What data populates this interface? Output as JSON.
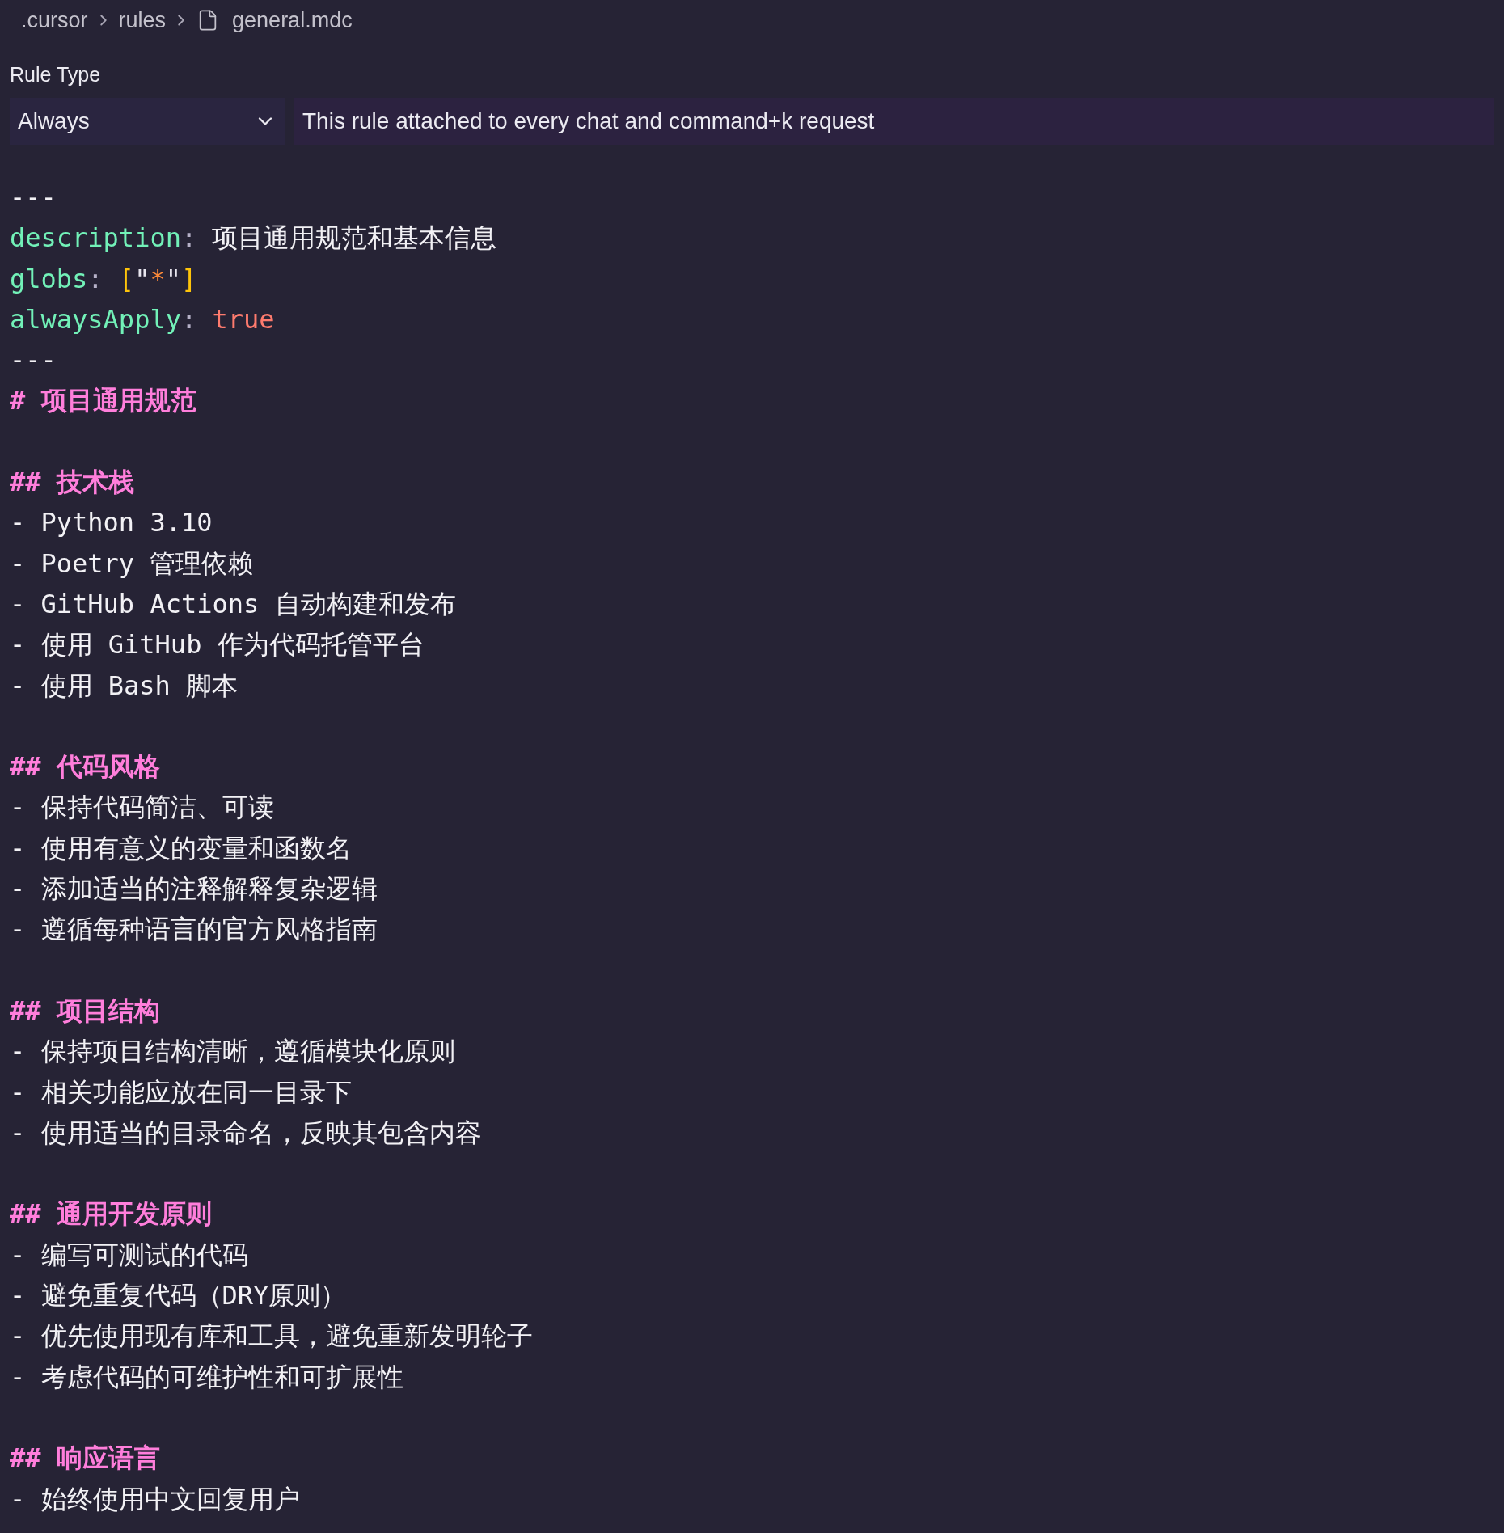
{
  "breadcrumb": [
    {
      "label": ".cursor",
      "kind": "folder"
    },
    {
      "label": "rules",
      "kind": "folder"
    },
    {
      "label": "general.mdc",
      "kind": "file"
    }
  ],
  "rule_type": {
    "label": "Rule Type",
    "value": "Always",
    "description": "This rule attached to every chat and command+k request"
  },
  "editor": {
    "lines": [
      {
        "kind": "fence",
        "text": "---"
      },
      {
        "kind": "field",
        "tokens": [
          {
            "kind": "key",
            "text": "description"
          },
          {
            "kind": "punct",
            "text": ":"
          },
          {
            "kind": "string",
            "text": "项目通用规范和基本信息"
          }
        ]
      },
      {
        "kind": "field",
        "tokens": [
          {
            "kind": "key",
            "text": "globs"
          },
          {
            "kind": "punct",
            "text": ":"
          },
          {
            "kind": "bracket",
            "text": "["
          },
          {
            "kind": "quote",
            "text": "\""
          },
          {
            "kind": "symbol",
            "text": "*"
          },
          {
            "kind": "quote",
            "text": "\""
          },
          {
            "kind": "bracket",
            "text": "]"
          }
        ]
      },
      {
        "kind": "field",
        "tokens": [
          {
            "kind": "key",
            "text": "alwaysApply"
          },
          {
            "kind": "punct",
            "text": ":"
          },
          {
            "kind": "boolean",
            "text": "true"
          }
        ]
      },
      {
        "kind": "fence",
        "text": "---"
      },
      {
        "kind": "heading",
        "text": "# 项目通用规范"
      },
      {
        "kind": "blank"
      },
      {
        "kind": "heading",
        "text": "## 技术栈"
      },
      {
        "kind": "item",
        "text": "- Python 3.10"
      },
      {
        "kind": "item",
        "text": "- Poetry 管理依赖"
      },
      {
        "kind": "item",
        "text": "- GitHub Actions 自动构建和发布"
      },
      {
        "kind": "item",
        "text": "- 使用 GitHub 作为代码托管平台"
      },
      {
        "kind": "item",
        "text": "- 使用 Bash 脚本"
      },
      {
        "kind": "blank"
      },
      {
        "kind": "heading",
        "text": "## 代码风格"
      },
      {
        "kind": "item",
        "text": "- 保持代码简洁、可读"
      },
      {
        "kind": "item",
        "text": "- 使用有意义的变量和函数名"
      },
      {
        "kind": "item",
        "text": "- 添加适当的注释解释复杂逻辑"
      },
      {
        "kind": "item",
        "text": "- 遵循每种语言的官方风格指南"
      },
      {
        "kind": "blank"
      },
      {
        "kind": "heading",
        "text": "## 项目结构"
      },
      {
        "kind": "item",
        "text": "- 保持项目结构清晰，遵循模块化原则"
      },
      {
        "kind": "item",
        "text": "- 相关功能应放在同一目录下"
      },
      {
        "kind": "item",
        "text": "- 使用适当的目录命名，反映其包含内容"
      },
      {
        "kind": "blank"
      },
      {
        "kind": "heading",
        "text": "## 通用开发原则"
      },
      {
        "kind": "item",
        "text": "- 编写可测试的代码"
      },
      {
        "kind": "item",
        "text": "- 避免重复代码（DRY原则）"
      },
      {
        "kind": "item",
        "text": "- 优先使用现有库和工具，避免重新发明轮子"
      },
      {
        "kind": "item",
        "text": "- 考虑代码的可维护性和可扩展性"
      },
      {
        "kind": "blank"
      },
      {
        "kind": "heading",
        "text": "## 响应语言"
      },
      {
        "kind": "item",
        "text": "- 始终使用中文回复用户"
      }
    ]
  }
}
